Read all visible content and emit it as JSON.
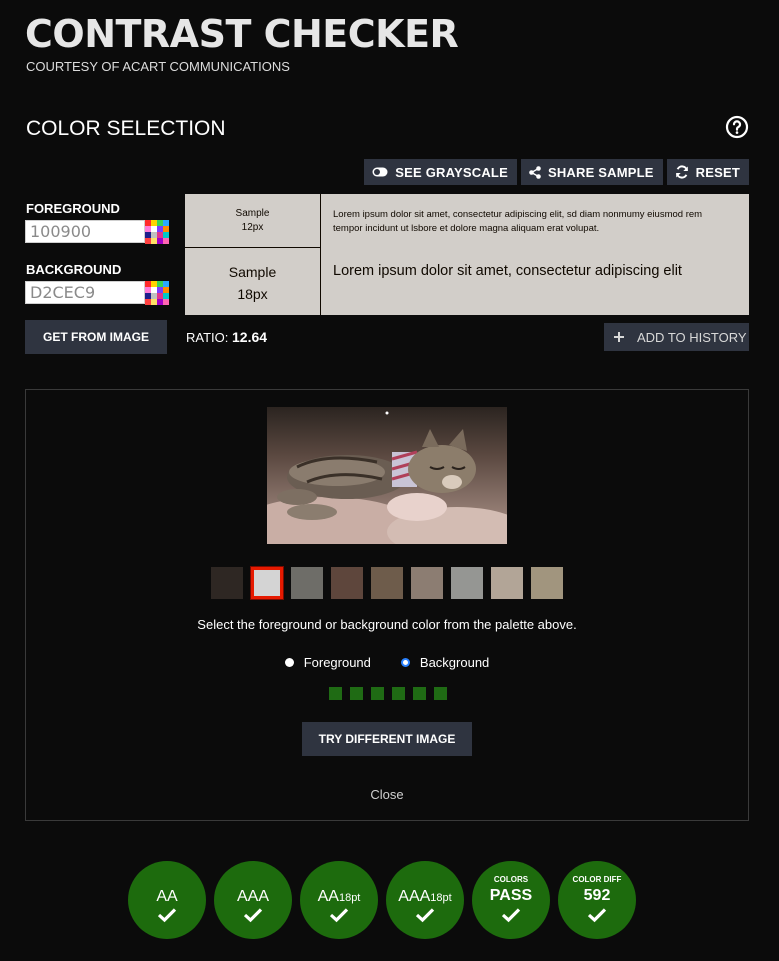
{
  "header": {
    "title": "CONTRAST CHECKER",
    "subtitle": "COURTESY OF ACART COMMUNICATIONS"
  },
  "section": {
    "title": "COLOR SELECTION"
  },
  "toolbar": {
    "grayscale_label": "SEE GRAYSCALE",
    "share_label": "SHARE SAMPLE",
    "reset_label": "RESET"
  },
  "foreground": {
    "label": "FOREGROUND",
    "value": "100900"
  },
  "background": {
    "label": "BACKGROUND",
    "value": "D2CEC9"
  },
  "get_from_image_label": "GET FROM IMAGE",
  "sample": {
    "small_label_1": "Sample",
    "small_label_2": "12px",
    "large_label_1": "Sample",
    "large_label_2": "18px",
    "small_text": "Lorem ipsum dolor sit amet, consectetur adipiscing elit, sd diam nonmumy eiusmod rem tempor incidunt ut lsbore et dolore magna aliquam erat volupat.",
    "large_text": "Lorem ipsum dolor sit amet, consectetur adipiscing elit",
    "fg_color": "#100900",
    "bg_color": "#D2CEC9"
  },
  "ratio": {
    "label": "RATIO:",
    "value": "12.64"
  },
  "add_history_label": "ADD TO HISTORY",
  "image_panel": {
    "palette": [
      "#2e2723",
      "#d4d4d4",
      "#6e6d68",
      "#5e463c",
      "#6e5c4b",
      "#8c7d72",
      "#959693",
      "#b2a597",
      "#a1957e"
    ],
    "selected_index": 1,
    "instruction": "Select the foreground or background color from the palette above.",
    "radio_foreground": "Foreground",
    "radio_background": "Background",
    "selected_radio": "Background",
    "progress_steps": 6,
    "try_different_label": "TRY DIFFERENT IMAGE",
    "close_label": "Close"
  },
  "results": {
    "aa": "AA",
    "aaa": "AAA",
    "aa18_main": "AA",
    "aa18_sub": "18pt",
    "aaa18_main": "AAA",
    "aaa18_sub": "18pt",
    "colors_small": "COLORS",
    "colors_value": "PASS",
    "diff_small": "COLOR DIFF",
    "diff_value": "592",
    "pass_color": "#1d6b0d"
  }
}
